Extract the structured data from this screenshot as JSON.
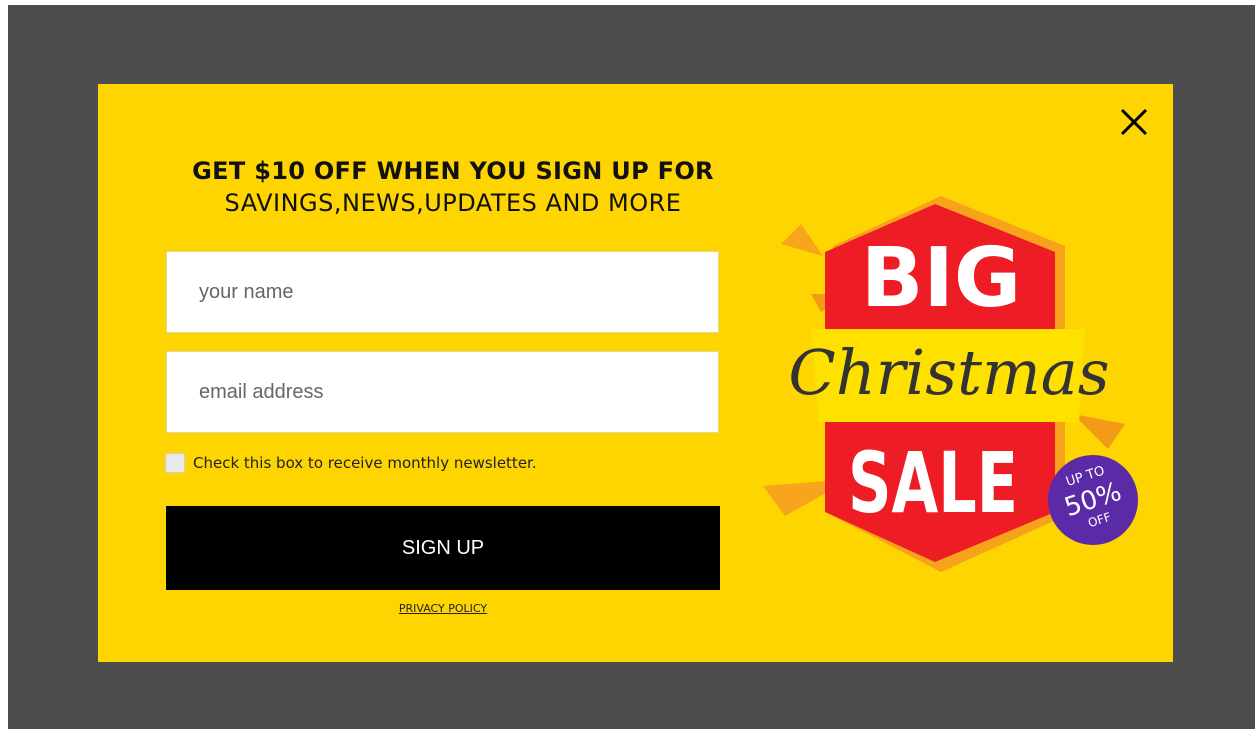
{
  "popup": {
    "headline_bold": "GET $10 OFF WHEN YOU SIGN UP FOR",
    "headline_regular": "SAVINGS,NEWS,UPDATES AND MORE",
    "name_placeholder": "your name",
    "email_placeholder": "email address",
    "newsletter_label": "Check this box to receive monthly newsletter.",
    "signup_label": "SIGN UP",
    "privacy_label": "PRIVACY POLICY",
    "close_icon": "close-icon"
  },
  "promo_art": {
    "big_text": "BIG",
    "christmas_text": "Christmas",
    "sale_text": "SALE",
    "badge_line1": "UP TO",
    "badge_line2": "50%",
    "badge_line3": "OFF"
  },
  "colors": {
    "overlay": "#4d4d4d",
    "popup_background": "#fed500",
    "button_background": "#000000",
    "sale_red": "#ee1c25",
    "badge_purple": "#5b2aa7"
  }
}
